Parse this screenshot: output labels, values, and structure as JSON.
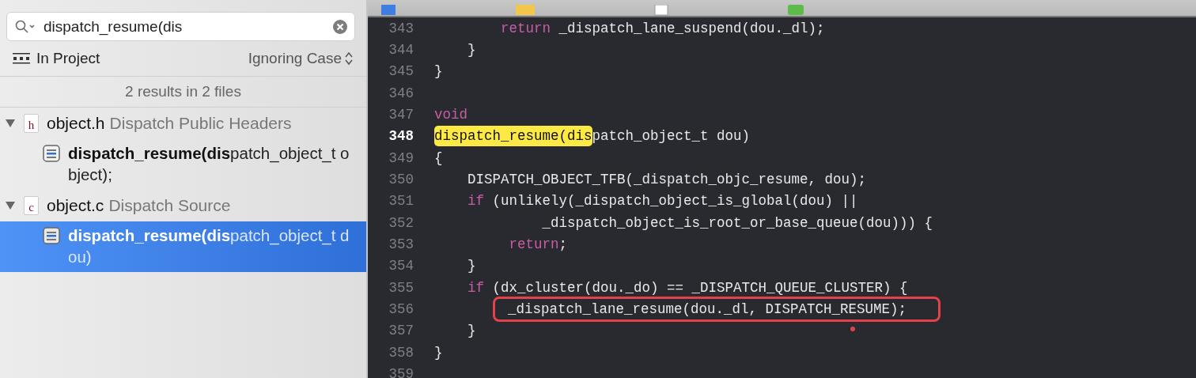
{
  "search": {
    "value": "dispatch_resume(dis"
  },
  "scope": {
    "label": "In Project"
  },
  "case_mode": {
    "label": "Ignoring Case"
  },
  "summary": "2 results in 2 files",
  "results": [
    {
      "file": "object.h",
      "icon_letter": "h",
      "group": "Dispatch Public Headers",
      "expanded": true,
      "children": [
        {
          "text": "**dispatch_resume(dis**patch_object_t object);",
          "selected": false
        }
      ]
    },
    {
      "file": "object.c",
      "icon_letter": "c",
      "group": "Dispatch Source",
      "expanded": true,
      "children": [
        {
          "text": "**dispatch_resume(dis**patch_object_t dou)",
          "selected": true
        }
      ]
    }
  ],
  "editor": {
    "lines": [
      {
        "number": "343",
        "current": false,
        "tokens": [
          {
            "kind": "keyword",
            "text": "        return"
          },
          {
            "kind": "plain",
            "text": " _dispatch_lane_suspend(dou._dl);"
          }
        ]
      },
      {
        "number": "344",
        "current": false,
        "tokens": [
          {
            "kind": "plain",
            "text": "    }"
          }
        ]
      },
      {
        "number": "345",
        "current": false,
        "tokens": [
          {
            "kind": "plain",
            "text": "}"
          }
        ]
      },
      {
        "number": "346",
        "current": false
      },
      {
        "number": "347",
        "current": false,
        "tokens": [
          {
            "kind": "keyword",
            "text": "void"
          }
        ]
      },
      {
        "number": "348",
        "current": true,
        "tokens": [
          {
            "kind": "match",
            "text": "dispatch_resume(dis"
          },
          {
            "kind": "plain",
            "text": "patch_object_t dou)"
          }
        ]
      },
      {
        "number": "349",
        "current": false,
        "tokens": [
          {
            "kind": "plain",
            "text": "{"
          }
        ]
      },
      {
        "number": "350",
        "current": false,
        "tokens": [
          {
            "kind": "plain",
            "text": "    DISPATCH_OBJECT_TFB(_dispatch_objc_resume, dou);"
          }
        ]
      },
      {
        "number": "351",
        "current": false,
        "tokens": [
          {
            "kind": "keyword",
            "text": "    if"
          },
          {
            "kind": "plain",
            "text": " (unlikely(_dispatch_object_is_global(dou) ||"
          }
        ]
      },
      {
        "number": "352",
        "current": false,
        "tokens": [
          {
            "kind": "plain",
            "text": "             _dispatch_object_is_root_or_base_queue(dou))) {"
          }
        ]
      },
      {
        "number": "353",
        "current": false,
        "tokens": [
          {
            "kind": "keyword",
            "text": "         return"
          },
          {
            "kind": "plain",
            "text": ";"
          }
        ]
      },
      {
        "number": "354",
        "current": false,
        "tokens": [
          {
            "kind": "plain",
            "text": "    }"
          }
        ]
      },
      {
        "number": "355",
        "current": false,
        "tokens": [
          {
            "kind": "keyword",
            "text": "    if"
          },
          {
            "kind": "plain",
            "text": " (dx_cluster(dou._do) == _DISPATCH_QUEUE_CLUSTER) {"
          }
        ]
      },
      {
        "number": "356",
        "current": false,
        "boxed": true,
        "tokens": [
          {
            "kind": "plain",
            "text": "_dispatch_lane_resume(dou._dl, DISPATCH_RESUME);"
          }
        ]
      },
      {
        "number": "357",
        "current": false,
        "tokens": [
          {
            "kind": "plain",
            "text": "    }"
          }
        ]
      },
      {
        "number": "358",
        "current": false,
        "tokens": [
          {
            "kind": "plain",
            "text": "}"
          }
        ]
      },
      {
        "number": "359",
        "current": false
      }
    ]
  }
}
